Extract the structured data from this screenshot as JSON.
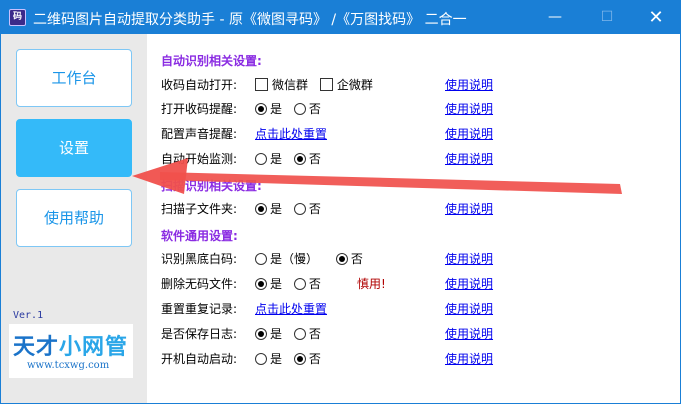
{
  "window": {
    "title": "二维码图片自动提取分类助手 - 原《微图寻码》 /《万图找码》 二合一",
    "app_icon_text": "码",
    "minimize_glyph": "—",
    "maximize_glyph": "☐",
    "close_glyph": "✕"
  },
  "sidebar": {
    "items": [
      {
        "label": "工作台",
        "active": false
      },
      {
        "label": "设置",
        "active": true
      },
      {
        "label": "使用帮助",
        "active": false
      }
    ],
    "version": "Ver.1",
    "logo": {
      "part1": "天才",
      "part2": "小网管",
      "url": "www.tcxwg.com"
    }
  },
  "settings": {
    "section_auto": "自动识别相关设置:",
    "section_scan": "扫描识别相关设置:",
    "section_general": "软件通用设置:",
    "help_label": "使用说明",
    "yes": "是",
    "no": "否",
    "rows": {
      "collect": {
        "label": "收码自动打开:",
        "opt1": "微信群",
        "opt2": "企微群"
      },
      "remind": {
        "label": "打开收码提醒:"
      },
      "sound": {
        "label": "配置声音提醒:",
        "link": "点击此处重置"
      },
      "monitor": {
        "label": "自动开始监测:"
      },
      "subfolder": {
        "label": "扫描子文件夹:"
      },
      "blackwhite": {
        "label": "识别黑底白码:",
        "yes_slow": "是（慢）"
      },
      "delete": {
        "label": "删除无码文件:",
        "warn": "慎用!"
      },
      "reset": {
        "label": "重置重复记录:",
        "link": "点击此处重置"
      },
      "log": {
        "label": "是否保存日志:"
      },
      "startup": {
        "label": "开机自动启动:"
      }
    }
  },
  "colors": {
    "titlebar": "#1a7fd6",
    "active_nav": "#34baf9",
    "section": "#8a2be2",
    "arrow": "#f0504c"
  }
}
